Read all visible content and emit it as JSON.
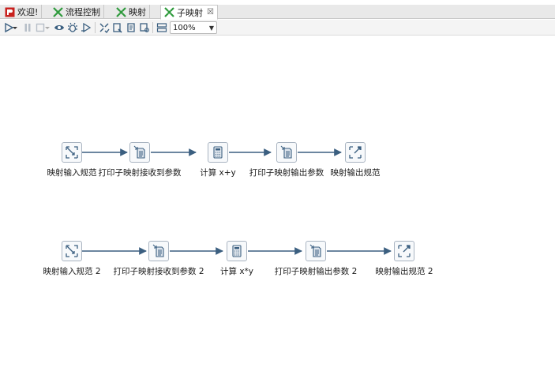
{
  "tabs": [
    {
      "label": "欢迎!",
      "icon": "pentaho-logo-icon"
    },
    {
      "label": "流程控制",
      "icon": "job-icon"
    },
    {
      "label": "映射",
      "icon": "transformation-icon"
    },
    {
      "label": "子映射",
      "icon": "transformation-icon",
      "close": "☒"
    }
  ],
  "toolbar": {
    "zoom": "100%",
    "icons": [
      "run-icon",
      "run-options-dropdown-icon",
      "pause-icon",
      "stop-icon",
      "stop-dropdown-icon",
      "preview-icon",
      "debug-icon",
      "replay-icon",
      "verify-icon",
      "impact-icon",
      "sql-icon",
      "explore-db-icon",
      "show-results-icon"
    ]
  },
  "flow1": {
    "nodes": [
      {
        "label": "映射输入规范",
        "icon": "mapping-input-icon"
      },
      {
        "label": "打印子映射接收到参数",
        "icon": "write-to-log-icon"
      },
      {
        "label": "计算 x+y",
        "icon": "calculator-icon"
      },
      {
        "label": "打印子映射输出参数",
        "icon": "write-to-log-icon"
      },
      {
        "label": "映射输出规范",
        "icon": "mapping-output-icon"
      }
    ]
  },
  "flow2": {
    "nodes": [
      {
        "label": "映射输入规范 2",
        "icon": "mapping-input-icon"
      },
      {
        "label": "打印子映射接收到参数 2",
        "icon": "write-to-log-icon"
      },
      {
        "label": "计算 x*y",
        "icon": "calculator-icon"
      },
      {
        "label": "打印子映射输出参数 2",
        "icon": "write-to-log-icon"
      },
      {
        "label": "映射输出规范 2",
        "icon": "mapping-output-icon"
      }
    ]
  },
  "colors": {
    "arrow": "#3b5f80",
    "node_border": "#a9b4c1",
    "job_green": "#2e9a3c",
    "logo_red": "#c8211e"
  }
}
